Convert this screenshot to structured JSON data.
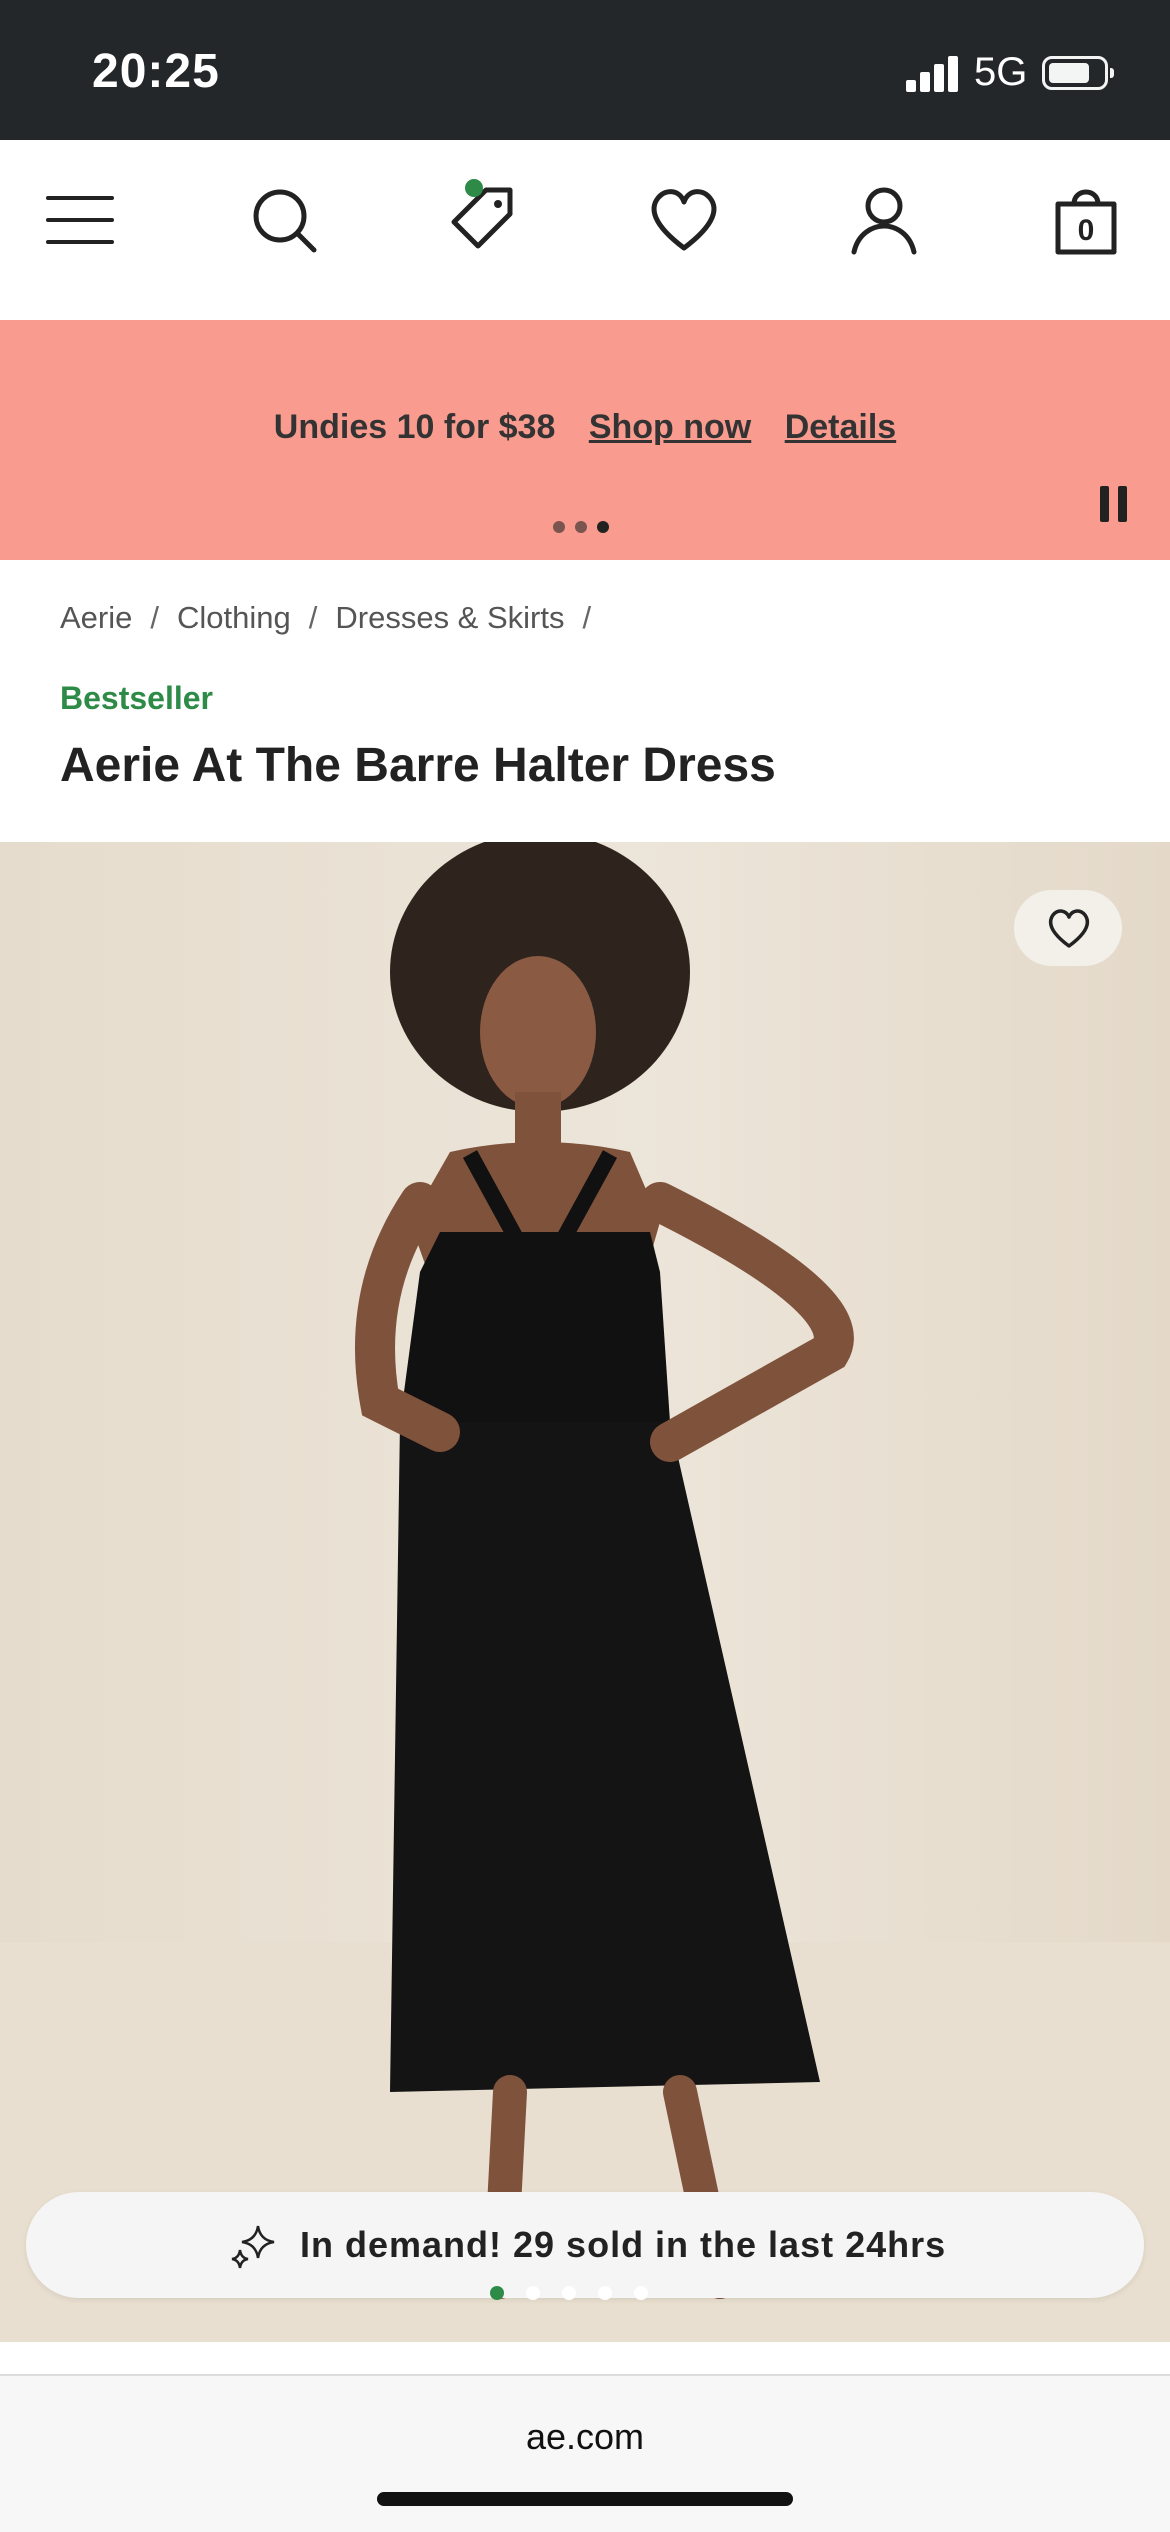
{
  "status": {
    "time": "20:25",
    "network": "5G"
  },
  "nav": {
    "bag_count": "0"
  },
  "promo": {
    "text": "Undies 10 for $38",
    "shop_link": "Shop now",
    "details_link": "Details"
  },
  "breadcrumb": [
    "Aerie",
    "Clothing",
    "Dresses & Skirts"
  ],
  "product": {
    "badge": "Bestseller",
    "title": "Aerie At The Barre Halter Dress"
  },
  "demand_banner": {
    "text": "In demand! 29 sold in the last 24hrs"
  },
  "browser": {
    "url": "ae.com"
  },
  "colors": {
    "promo_bg": "#f99b8e",
    "accent_green": "#2e8b47",
    "status_bar": "#23272a"
  }
}
